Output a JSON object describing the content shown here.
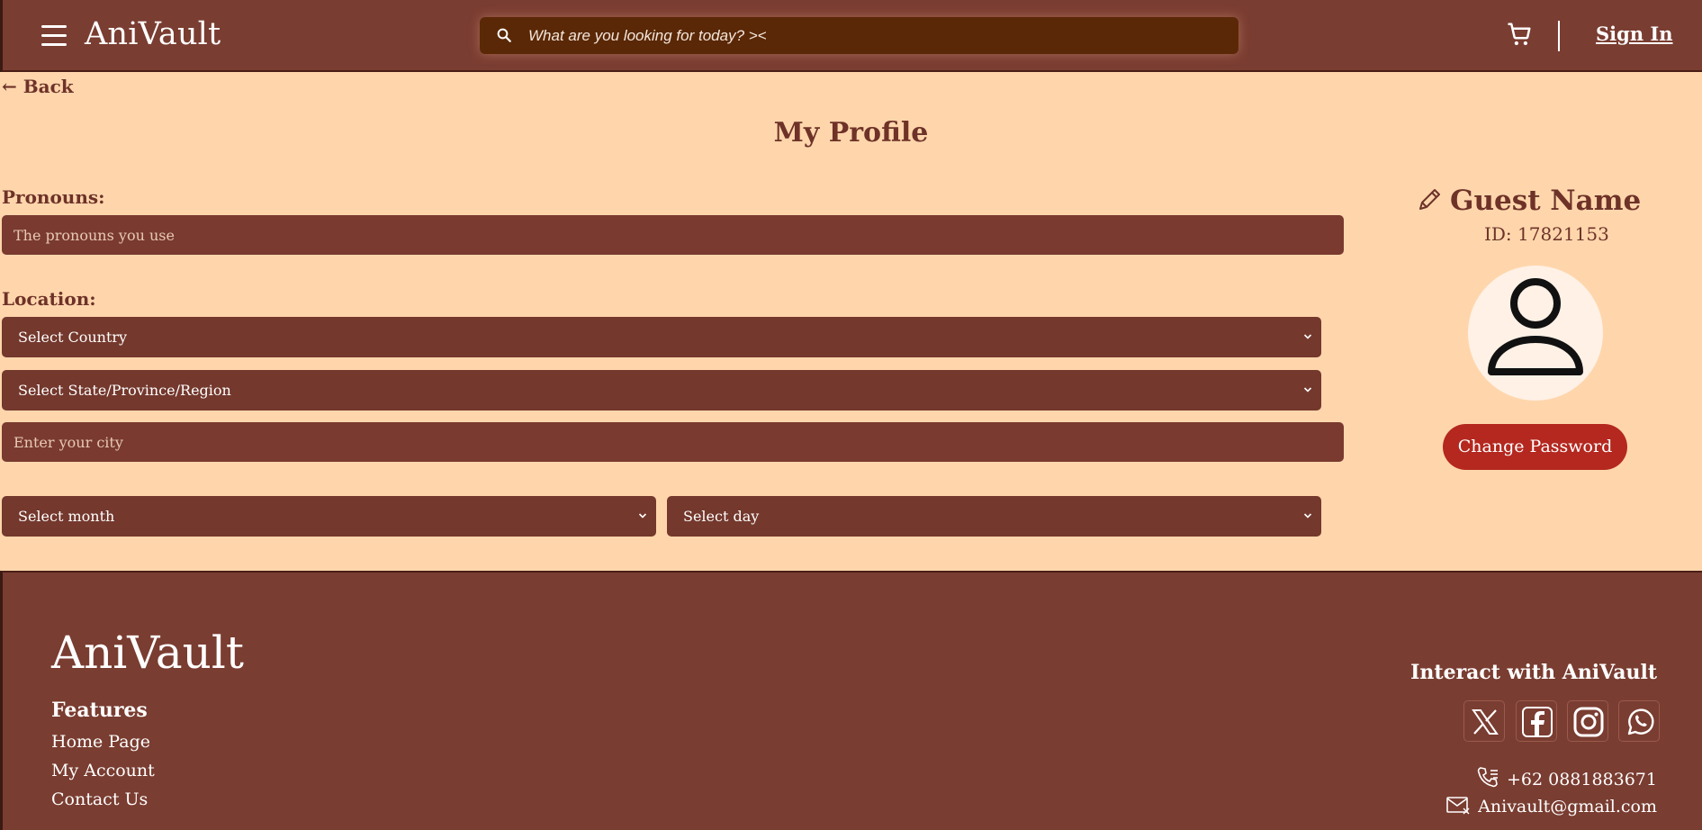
{
  "header": {
    "logo": "AniVault",
    "search_placeholder": "What are you looking for today? ><",
    "sign_in": "Sign In",
    "icons": [
      "menu-icon",
      "search-icon",
      "cart-icon"
    ]
  },
  "back": "← Back",
  "page_title": "My Profile",
  "form": {
    "pronouns_label": "Pronouns:",
    "pronouns_placeholder": "The pronouns you use",
    "location_label": "Location:",
    "country_select": "Select Country",
    "state_select": "Select State/Province/Region",
    "city_placeholder": "Enter your city",
    "month_select": "Select month",
    "day_select": "Select day"
  },
  "profile": {
    "name": "Guest Name",
    "id": "ID: 17821153",
    "change_password": "Change Password",
    "icons": [
      "pencil-icon",
      "avatar-user-icon"
    ]
  },
  "footer": {
    "logo": "AniVault",
    "features_title": "Features",
    "links": [
      "Home Page",
      "My Account",
      "Contact Us"
    ],
    "interact_title": "Interact with AniVault",
    "social": [
      "x-icon",
      "facebook-icon",
      "instagram-icon",
      "whatsapp-icon"
    ],
    "phone": "+62 0881883671",
    "email": "Anivault@gmail.com"
  },
  "colors": {
    "header_bg": "#7a3d31",
    "page_bg": "#ffd6ac",
    "field_bg": "#74382d",
    "button_red": "#b4281f",
    "search_bg": "#5a2806"
  }
}
